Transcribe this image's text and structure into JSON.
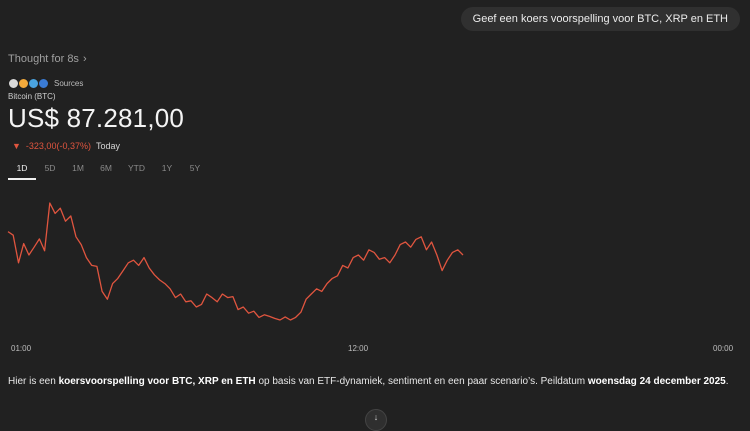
{
  "user_message": "Geef een koers voorspelling voor BTC, XRP en ETH",
  "thought": {
    "label": "Thought for 8s",
    "chevron": "›"
  },
  "sources": {
    "label": "Sources",
    "icons": [
      "source-icon-1",
      "source-icon-2",
      "source-icon-3",
      "source-icon-4"
    ]
  },
  "asset": {
    "name": "Bitcoin (BTC)",
    "price": "US$ 87.281,00",
    "change_arrow": "▼",
    "change": "-323,00(-0,37%)",
    "change_period": "Today"
  },
  "tabs": [
    {
      "label": "1D",
      "active": true
    },
    {
      "label": "5D",
      "active": false
    },
    {
      "label": "1M",
      "active": false
    },
    {
      "label": "6M",
      "active": false
    },
    {
      "label": "YTD",
      "active": false
    },
    {
      "label": "1Y",
      "active": false
    },
    {
      "label": "5Y",
      "active": false
    }
  ],
  "chart_data": {
    "type": "line",
    "title": "",
    "x_ticks": [
      "01:00",
      "12:00",
      "00:00"
    ],
    "color": "#e0553f",
    "values": [
      88150,
      88080,
      87550,
      87920,
      87700,
      87850,
      88010,
      87780,
      88700,
      88500,
      88600,
      88350,
      88450,
      88050,
      87900,
      87650,
      87500,
      87480,
      87000,
      86850,
      87150,
      87250,
      87400,
      87550,
      87600,
      87500,
      87650,
      87450,
      87320,
      87220,
      87150,
      87050,
      86880,
      86950,
      86800,
      86820,
      86700,
      86750,
      86950,
      86880,
      86800,
      86950,
      86880,
      86900,
      86650,
      86700,
      86580,
      86620,
      86500,
      86550,
      86520,
      86480,
      86450,
      86510,
      86450,
      86500,
      86600,
      86850,
      86950,
      87050,
      87000,
      87150,
      87250,
      87300,
      87500,
      87450,
      87650,
      87700,
      87600,
      87800,
      87750,
      87620,
      87650,
      87550,
      87700,
      87900,
      87950,
      87850,
      88000,
      88050,
      87800,
      87950,
      87700,
      87400,
      87600,
      87750,
      87800,
      87700
    ]
  },
  "paragraph": {
    "p1": "Hier is een ",
    "b1": "koersvoorspelling voor BTC, XRP en ETH",
    "p2": " op basis van ETF-dynamiek, sentiment en een paar scenario’s. Peildatum ",
    "b2": "woensdag 24 december 2025",
    "p3": "."
  },
  "scroll_icon": "↓"
}
